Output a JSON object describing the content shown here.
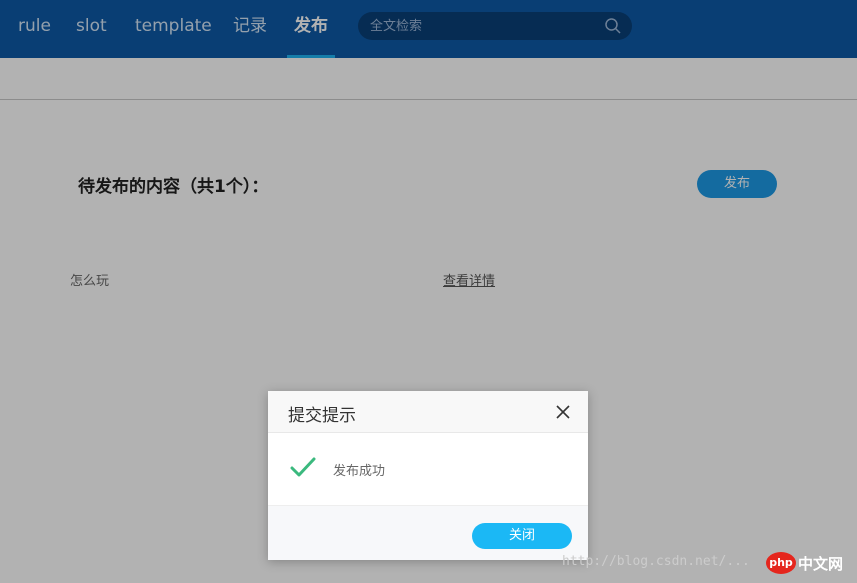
{
  "nav": {
    "items": [
      {
        "label": "rule"
      },
      {
        "label": "slot"
      },
      {
        "label": "template"
      },
      {
        "label": "记录"
      },
      {
        "label": "发布",
        "active": true
      }
    ]
  },
  "search": {
    "placeholder": "全文检索",
    "icon": "search-icon"
  },
  "main": {
    "heading": "待发布的内容（共1个）：",
    "publish_label": "发布",
    "item_name": "怎么玩",
    "item_link": "查看详情"
  },
  "dialog": {
    "title": "提交提示",
    "message": "发布成功",
    "close_label": "关闭",
    "icons": {
      "close": "close-icon",
      "success": "check-icon"
    }
  },
  "watermark": {
    "url": "http://blog.csdn.net/...",
    "brand": "中文网",
    "logo": "php"
  },
  "colors": {
    "nav_bg": "#0d5aa7",
    "accent": "#1fb4f3",
    "publish_button": "#1d9ae6",
    "success_green": "#3bb97e"
  }
}
